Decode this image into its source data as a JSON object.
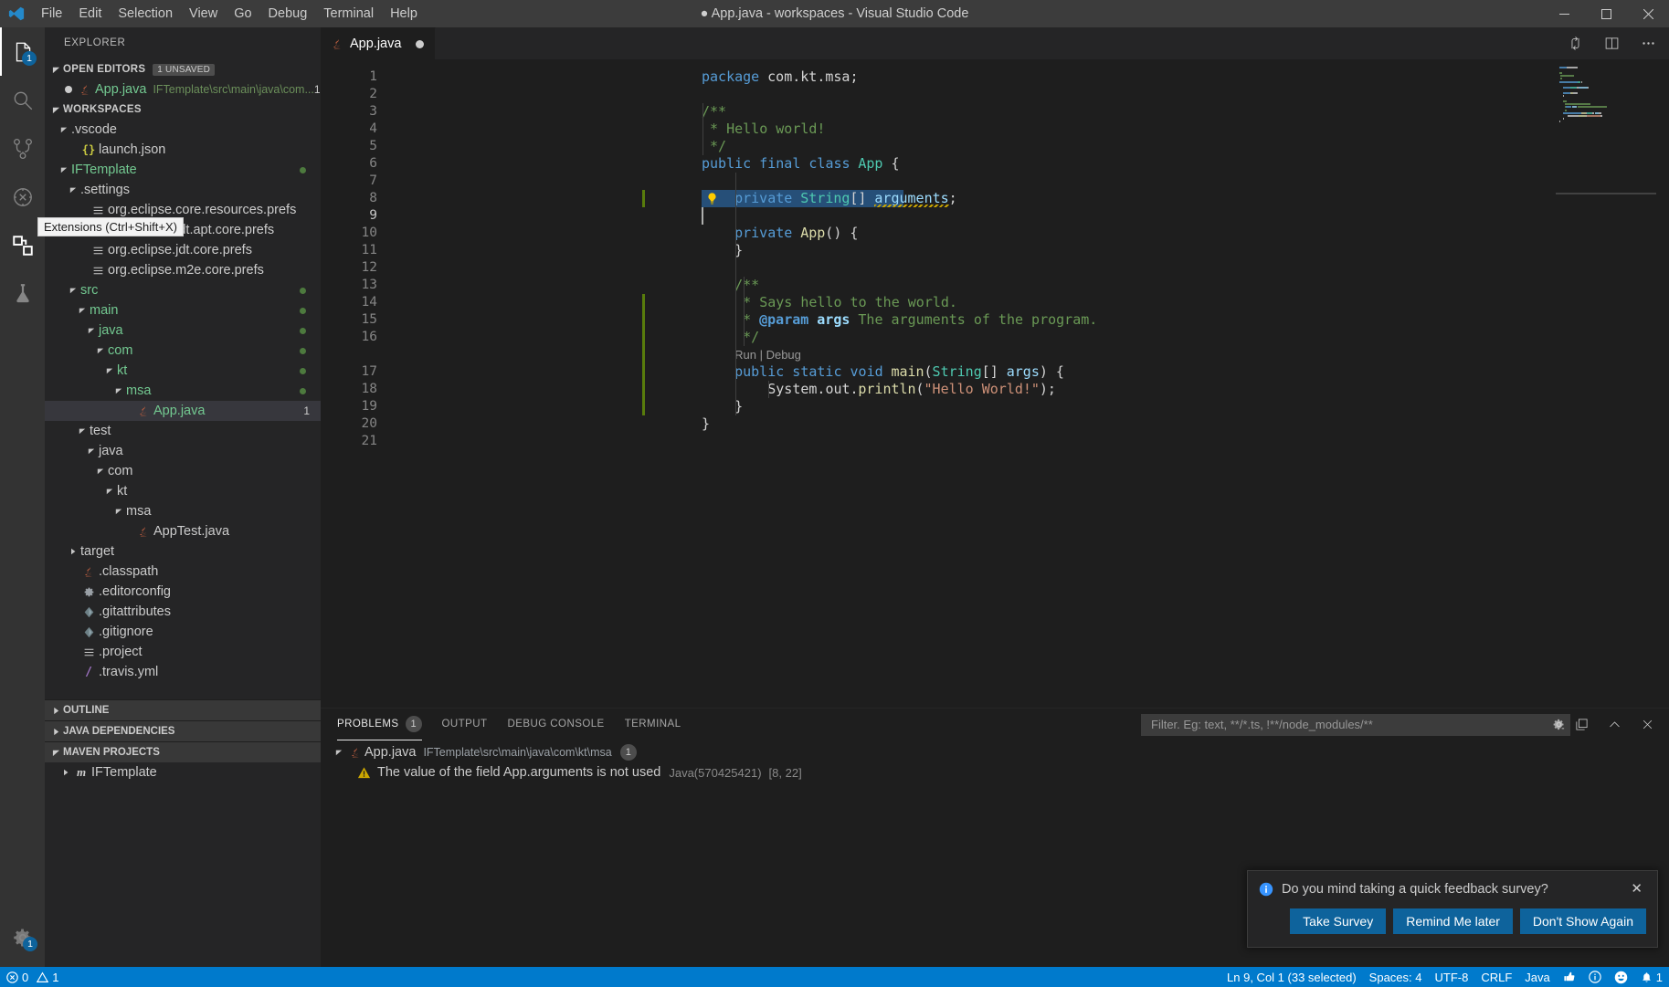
{
  "window": {
    "title": "● App.java - workspaces - Visual Studio Code",
    "minimize": "–",
    "maximize": "❑",
    "close": "✕"
  },
  "menubar": [
    "File",
    "Edit",
    "Selection",
    "View",
    "Go",
    "Debug",
    "Terminal",
    "Help"
  ],
  "activitybar": {
    "items": [
      {
        "name": "explorer",
        "icon": "files-icon",
        "badge": "1",
        "active": true
      },
      {
        "name": "search",
        "icon": "search-icon",
        "badge": "",
        "active": false
      },
      {
        "name": "source-control",
        "icon": "source-control-icon",
        "badge": "",
        "active": false
      },
      {
        "name": "run-debug",
        "icon": "run-debug-icon",
        "badge": "",
        "active": false
      },
      {
        "name": "extensions",
        "icon": "extensions-icon",
        "badge": "",
        "active": false
      },
      {
        "name": "testing",
        "icon": "beaker-icon",
        "badge": "",
        "active": false
      }
    ],
    "tooltip": "Extensions (Ctrl+Shift+X)",
    "manage": {
      "name": "manage-settings",
      "icon": "gear-icon",
      "badge": "1"
    }
  },
  "sidebar": {
    "title": "EXPLORER",
    "open_editors": {
      "label": "OPEN EDITORS",
      "badge": "1 UNSAVED",
      "items": [
        {
          "name": "App.java",
          "desc": "IFTemplate\\src\\main\\java\\com...",
          "count": "1",
          "icon": "java-icon",
          "unsaved": true
        }
      ]
    },
    "workspaces": {
      "label": "WORKSPACES",
      "tree": [
        {
          "label": ".vscode",
          "indent": 1,
          "type": "folder",
          "expanded": true,
          "color": "white"
        },
        {
          "label": "launch.json",
          "indent": 2,
          "type": "json",
          "color": "white"
        },
        {
          "label": "IFTemplate",
          "indent": 1,
          "type": "folder",
          "expanded": true,
          "color": "green",
          "gitdot": true
        },
        {
          "label": ".settings",
          "indent": 2,
          "type": "folder",
          "expanded": true,
          "color": "white"
        },
        {
          "label": "org.eclipse.core.resources.prefs",
          "indent": 3,
          "type": "prefs",
          "color": "white"
        },
        {
          "label": "org.eclipse.jdt.apt.core.prefs",
          "indent": 3,
          "type": "prefs",
          "color": "white"
        },
        {
          "label": "org.eclipse.jdt.core.prefs",
          "indent": 3,
          "type": "prefs",
          "color": "white"
        },
        {
          "label": "org.eclipse.m2e.core.prefs",
          "indent": 3,
          "type": "prefs",
          "color": "white"
        },
        {
          "label": "src",
          "indent": 2,
          "type": "folder",
          "expanded": true,
          "color": "green",
          "gitdot": true
        },
        {
          "label": "main",
          "indent": 3,
          "type": "folder",
          "expanded": true,
          "color": "green",
          "gitdot": true
        },
        {
          "label": "java",
          "indent": 4,
          "type": "folder",
          "expanded": true,
          "color": "green",
          "gitdot": true
        },
        {
          "label": "com",
          "indent": 5,
          "type": "folder",
          "expanded": true,
          "color": "green",
          "gitdot": true
        },
        {
          "label": "kt",
          "indent": 6,
          "type": "folder",
          "expanded": true,
          "color": "green",
          "gitdot": true
        },
        {
          "label": "msa",
          "indent": 7,
          "type": "folder",
          "expanded": true,
          "color": "green",
          "gitdot": true
        },
        {
          "label": "App.java",
          "indent": 8,
          "type": "java",
          "color": "green",
          "selected": true,
          "count": "1"
        },
        {
          "label": "test",
          "indent": 3,
          "type": "folder",
          "expanded": true,
          "color": "white"
        },
        {
          "label": "java",
          "indent": 4,
          "type": "folder",
          "expanded": true,
          "color": "white"
        },
        {
          "label": "com",
          "indent": 5,
          "type": "folder",
          "expanded": true,
          "color": "white"
        },
        {
          "label": "kt",
          "indent": 6,
          "type": "folder",
          "expanded": true,
          "color": "white"
        },
        {
          "label": "msa",
          "indent": 7,
          "type": "folder",
          "expanded": true,
          "color": "white"
        },
        {
          "label": "AppTest.java",
          "indent": 8,
          "type": "java",
          "color": "white"
        },
        {
          "label": "target",
          "indent": 2,
          "type": "folder",
          "expanded": false,
          "color": "white"
        },
        {
          "label": ".classpath",
          "indent": 2,
          "type": "java",
          "color": "white"
        },
        {
          "label": ".editorconfig",
          "indent": 2,
          "type": "gear",
          "color": "white"
        },
        {
          "label": ".gitattributes",
          "indent": 2,
          "type": "git",
          "color": "white"
        },
        {
          "label": ".gitignore",
          "indent": 2,
          "type": "git",
          "color": "white"
        },
        {
          "label": ".project",
          "indent": 2,
          "type": "prefs",
          "color": "white"
        },
        {
          "label": ".travis.yml",
          "indent": 2,
          "type": "yml",
          "color": "white"
        }
      ]
    },
    "bottom_sections": [
      {
        "label": "OUTLINE",
        "expanded": false
      },
      {
        "label": "JAVA DEPENDENCIES",
        "expanded": false
      },
      {
        "label": "MAVEN PROJECTS",
        "expanded": true
      }
    ],
    "maven_items": [
      {
        "label": "IFTemplate",
        "icon": "maven-icon"
      }
    ]
  },
  "editor": {
    "tab": {
      "label": "App.java",
      "icon": "java-icon",
      "dirty": true
    },
    "actions": [
      {
        "name": "split-editor-source-control-icon",
        "icon": "compare-icon"
      },
      {
        "name": "split-editor-right-icon",
        "icon": "split-icon"
      },
      {
        "name": "more-actions-icon",
        "icon": "ellipsis-icon"
      }
    ],
    "codelens": {
      "run": "Run",
      "sep": "|",
      "debug": "Debug",
      "line": 17
    },
    "lines": [
      {
        "n": 1,
        "tokens": [
          {
            "t": "package ",
            "c": "kw"
          },
          {
            "t": "com.kt.msa;",
            "c": "plain"
          }
        ]
      },
      {
        "n": 2,
        "tokens": []
      },
      {
        "n": 3,
        "tokens": [
          {
            "t": "/**",
            "c": "cmt"
          }
        ]
      },
      {
        "n": 4,
        "tokens": [
          {
            "t": " * Hello world!",
            "c": "cmt"
          }
        ]
      },
      {
        "n": 5,
        "tokens": [
          {
            "t": " */",
            "c": "cmt"
          }
        ]
      },
      {
        "n": 6,
        "tokens": [
          {
            "t": "public final class ",
            "c": "kw"
          },
          {
            "t": "App",
            "c": "type"
          },
          {
            "t": " {",
            "c": "plain"
          }
        ]
      },
      {
        "n": 7,
        "tokens": []
      },
      {
        "n": 8,
        "tokens": [
          {
            "t": "    ",
            "c": "plain"
          },
          {
            "t": "private ",
            "c": "kw"
          },
          {
            "t": "String",
            "c": "type"
          },
          {
            "t": "[] ",
            "c": "plain"
          },
          {
            "t": "arguments",
            "c": "var"
          },
          {
            "t": ";",
            "c": "plain"
          }
        ]
      },
      {
        "n": 9,
        "tokens": []
      },
      {
        "n": 10,
        "tokens": [
          {
            "t": "    ",
            "c": "plain"
          },
          {
            "t": "private ",
            "c": "kw"
          },
          {
            "t": "App",
            "c": "fn"
          },
          {
            "t": "() {",
            "c": "plain"
          }
        ]
      },
      {
        "n": 11,
        "tokens": [
          {
            "t": "    }",
            "c": "plain"
          }
        ]
      },
      {
        "n": 12,
        "tokens": []
      },
      {
        "n": 13,
        "tokens": [
          {
            "t": "    /**",
            "c": "cmt"
          }
        ]
      },
      {
        "n": 14,
        "tokens": [
          {
            "t": "     * Says hello to the world.",
            "c": "cmt"
          }
        ]
      },
      {
        "n": 15,
        "tokens": [
          {
            "t": "     * ",
            "c": "cmt"
          },
          {
            "t": "@param",
            "c": "jdoc"
          },
          {
            "t": " ",
            "c": "cmt"
          },
          {
            "t": "args",
            "c": "jparam"
          },
          {
            "t": " The arguments of the program.",
            "c": "cmt"
          }
        ]
      },
      {
        "n": 16,
        "tokens": [
          {
            "t": "     */",
            "c": "cmt"
          }
        ]
      },
      {
        "n": 17,
        "tokens": [
          {
            "t": "    ",
            "c": "plain"
          },
          {
            "t": "public static void ",
            "c": "kw"
          },
          {
            "t": "main",
            "c": "fn"
          },
          {
            "t": "(",
            "c": "plain"
          },
          {
            "t": "String",
            "c": "type"
          },
          {
            "t": "[] ",
            "c": "plain"
          },
          {
            "t": "args",
            "c": "param"
          },
          {
            "t": ") {",
            "c": "plain"
          }
        ]
      },
      {
        "n": 18,
        "tokens": [
          {
            "t": "        System.out.",
            "c": "plain"
          },
          {
            "t": "println",
            "c": "fn"
          },
          {
            "t": "(",
            "c": "plain"
          },
          {
            "t": "\"Hello World!\"",
            "c": "str"
          },
          {
            "t": ");",
            "c": "plain"
          }
        ]
      },
      {
        "n": 19,
        "tokens": [
          {
            "t": "    }",
            "c": "plain"
          }
        ]
      },
      {
        "n": 20,
        "tokens": [
          {
            "t": "}",
            "c": "plain"
          }
        ]
      },
      {
        "n": 21,
        "tokens": []
      }
    ],
    "selection_line": 8,
    "cursor_line": 9
  },
  "panel": {
    "tabs": [
      {
        "label": "PROBLEMS",
        "badge": "1",
        "active": true
      },
      {
        "label": "OUTPUT",
        "badge": "",
        "active": false
      },
      {
        "label": "DEBUG CONSOLE",
        "badge": "",
        "active": false
      },
      {
        "label": "TERMINAL",
        "badge": "",
        "active": false
      }
    ],
    "filter_placeholder": "Filter. Eg: text, **/*.ts, !**/node_modules/**",
    "filter_value": "",
    "actions": [
      {
        "name": "filter-settings-icon",
        "icon": "filter-gear-icon"
      },
      {
        "name": "maximize-panel-icon",
        "icon": "copy-icon"
      },
      {
        "name": "collapse-panel-icon",
        "icon": "chevron-up-icon"
      },
      {
        "name": "close-panel-icon",
        "icon": "close-icon"
      }
    ],
    "file_group": {
      "file": "App.java",
      "path": "IFTemplate\\src\\main\\java\\com\\kt\\msa",
      "count": "1"
    },
    "problems": [
      {
        "severity": "warning",
        "message": "The value of the field App.arguments is not used",
        "source": "Java(570425421)",
        "position": "[8, 22]"
      }
    ]
  },
  "notification": {
    "message": "Do you mind taking a quick feedback survey?",
    "close": "✕",
    "buttons": [
      "Take Survey",
      "Remind Me later",
      "Don't Show Again"
    ]
  },
  "statusbar": {
    "errors": "0",
    "warnings": "1",
    "right": [
      {
        "name": "editor-position",
        "label": "Ln 9, Col 1 (33 selected)"
      },
      {
        "name": "indentation",
        "label": "Spaces: 4"
      },
      {
        "name": "encoding",
        "label": "UTF-8"
      },
      {
        "name": "eol",
        "label": "CRLF"
      },
      {
        "name": "language-mode",
        "label": "Java"
      }
    ],
    "icons": [
      {
        "name": "thumbs-up-icon",
        "label": ""
      },
      {
        "name": "info-icon",
        "label": ""
      },
      {
        "name": "smiley-feedback-icon",
        "label": ""
      },
      {
        "name": "notifications-bell-icon",
        "label": "1"
      }
    ]
  },
  "colors": {
    "accent": "#007acc",
    "selection": "#264f78",
    "button": "#0e639c",
    "green": "#73c991",
    "warning": "#cca700"
  }
}
